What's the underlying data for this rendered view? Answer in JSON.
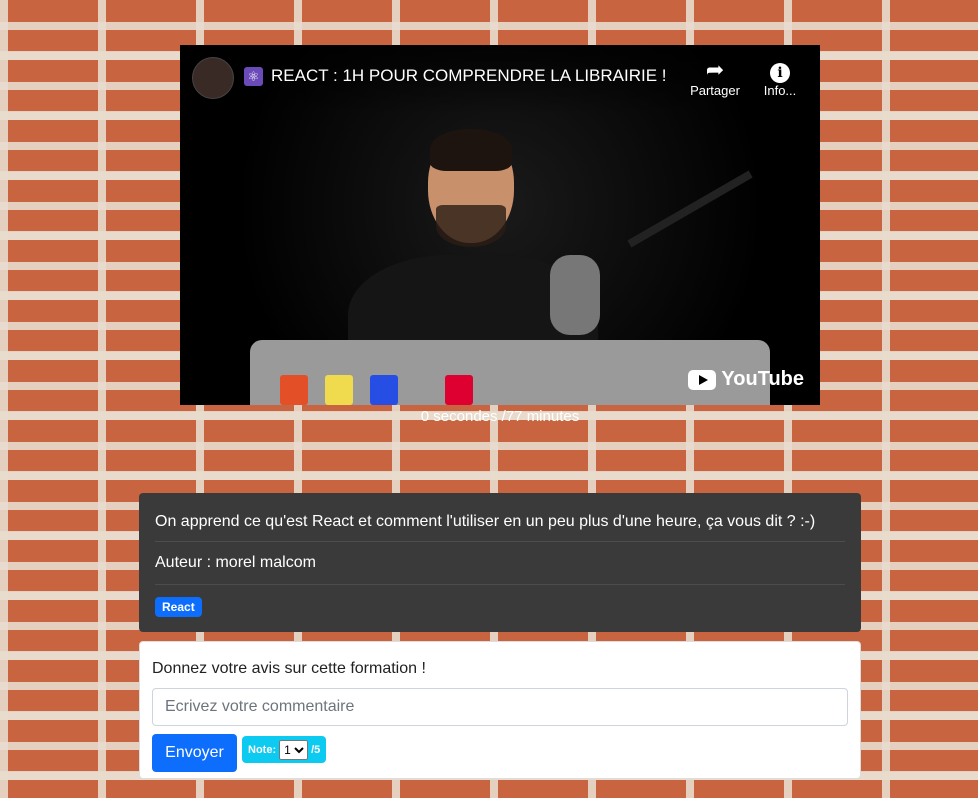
{
  "video": {
    "title": "REACT : 1H POUR COMPRENDRE LA LIBRAIRIE !",
    "react_emoji": "⚛",
    "share_label": "Partager",
    "info_label": "Info...",
    "youtube_label": "YouTube",
    "time_readout": "0 secondes /77 minutes"
  },
  "course": {
    "description": "On apprend ce qu'est React et comment l'utiliser en un peu plus d'une heure, ça vous dit ? :-)",
    "author": "Auteur : morel malcom",
    "tag": "React"
  },
  "feedback": {
    "prompt": "Donnez votre avis sur cette formation !",
    "placeholder": "Ecrivez votre commentaire",
    "send_label": "Envoyer",
    "note_label": "Note:",
    "note_value": "1",
    "note_max": "/5"
  }
}
